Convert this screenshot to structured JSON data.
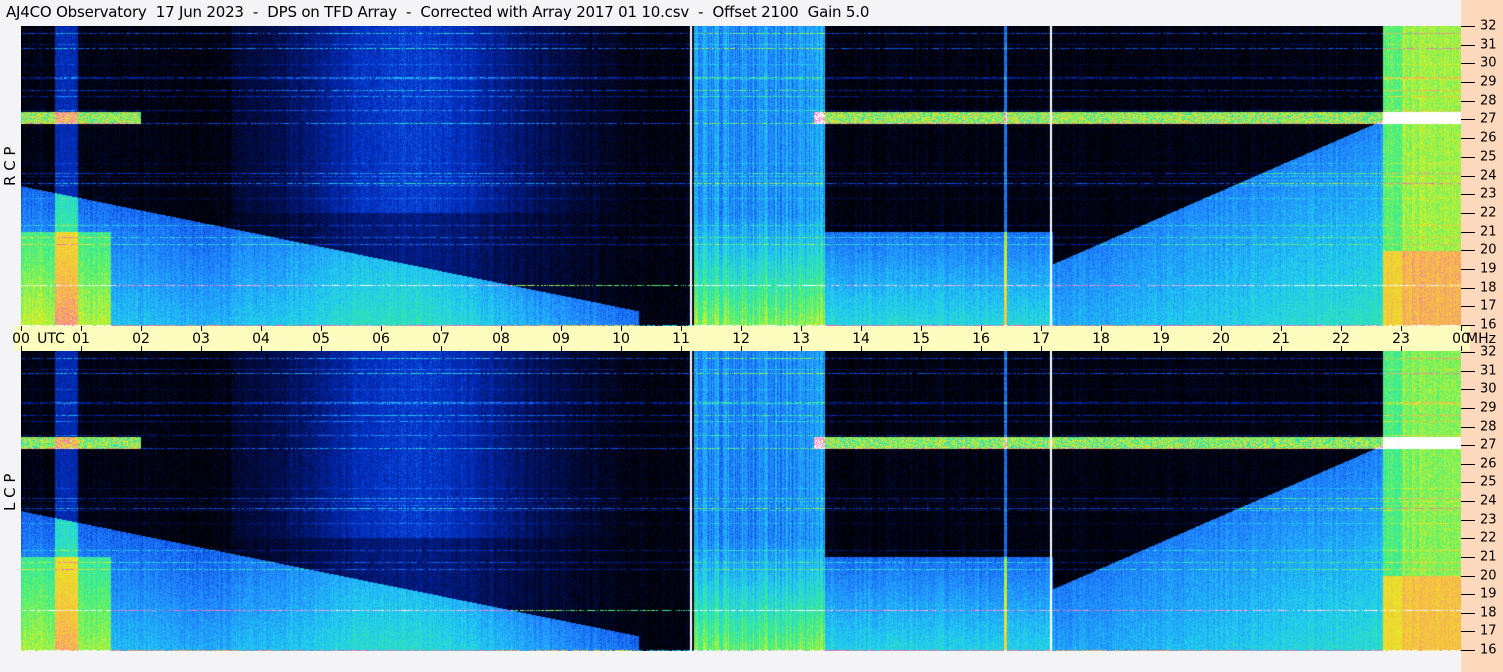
{
  "title": "AJ4CO Observatory  17 Jun 2023  -  DPS on TFD Array  -  Corrected with Array 2017 01 10.csv  -  Offset 2100  Gain 5.0",
  "chart_data": {
    "type": "heatmap",
    "title": "AJ4CO Observatory  17 Jun 2023  -  DPS on TFD Array  -  Corrected with Array 2017 01 10.csv  -  Offset 2100  Gain 5.0",
    "panels": [
      {
        "name": "R C P",
        "ylim": [
          16,
          32
        ]
      },
      {
        "name": "L C P",
        "ylim": [
          16,
          32
        ]
      }
    ],
    "x_unit": "UTC",
    "y_unit": "MHz",
    "xlim": [
      0,
      24
    ],
    "x_tick_labels": [
      "00",
      "01",
      "02",
      "03",
      "04",
      "05",
      "06",
      "07",
      "08",
      "09",
      "10",
      "11",
      "12",
      "13",
      "14",
      "15",
      "16",
      "17",
      "18",
      "19",
      "20",
      "21",
      "22",
      "23",
      "00"
    ],
    "y_tick_labels": [
      "32",
      "31",
      "30",
      "29",
      "28",
      "27",
      "26",
      "25",
      "24",
      "23",
      "22",
      "21",
      "20",
      "19",
      "18",
      "17",
      "16"
    ],
    "colormap": [
      "#000000",
      "#00105a",
      "#0030c8",
      "#2080ff",
      "#20d0f0",
      "#40f080",
      "#e0f020",
      "#f8c040",
      "#f060d0",
      "#ffffff"
    ],
    "vertical_markers_utc": [
      11.15,
      17.15
    ],
    "marker_colors": [
      "#ffffff",
      "#ff40a0"
    ]
  },
  "axis": {
    "utc_label": "UTC",
    "mhz_label": "MHz"
  }
}
